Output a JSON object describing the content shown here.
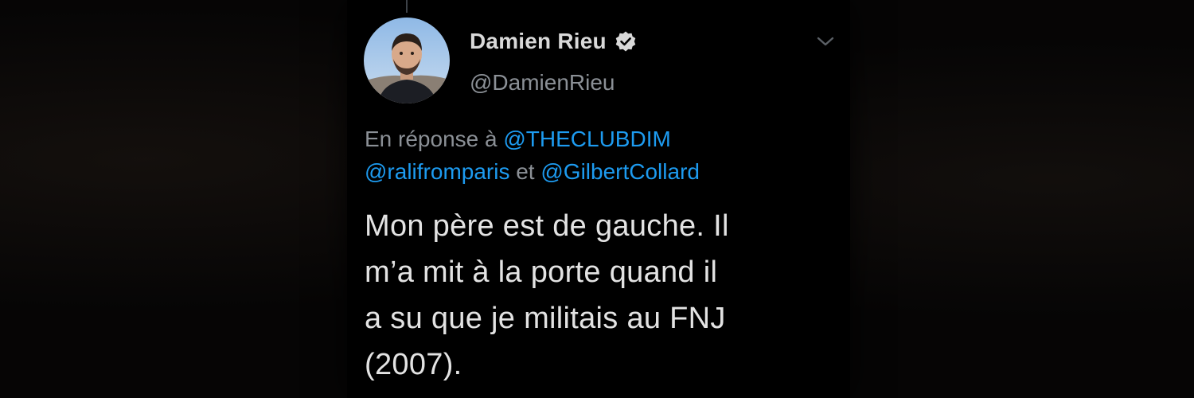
{
  "tweet": {
    "author": {
      "display_name": "Damien Rieu",
      "handle": "@DamienRieu",
      "verified": true
    },
    "reply_context": {
      "prefix": "En réponse à",
      "mentions": [
        "@THECLUBDIM",
        "@ralifromparis",
        "@GilbertCollard"
      ],
      "conjunction": "et"
    },
    "text_lines": [
      "Mon père est de gauche. Il",
      "m’a mit à la porte quand il",
      "a su que je militais au FNJ",
      "(2007)."
    ]
  },
  "icons": {
    "verified": "verified-badge-icon",
    "menu": "chevron-down-icon"
  },
  "colors": {
    "background": "#000000",
    "link": "#1d9bf0",
    "primary_text": "#e3e3e3",
    "secondary_text": "#8b9096"
  }
}
